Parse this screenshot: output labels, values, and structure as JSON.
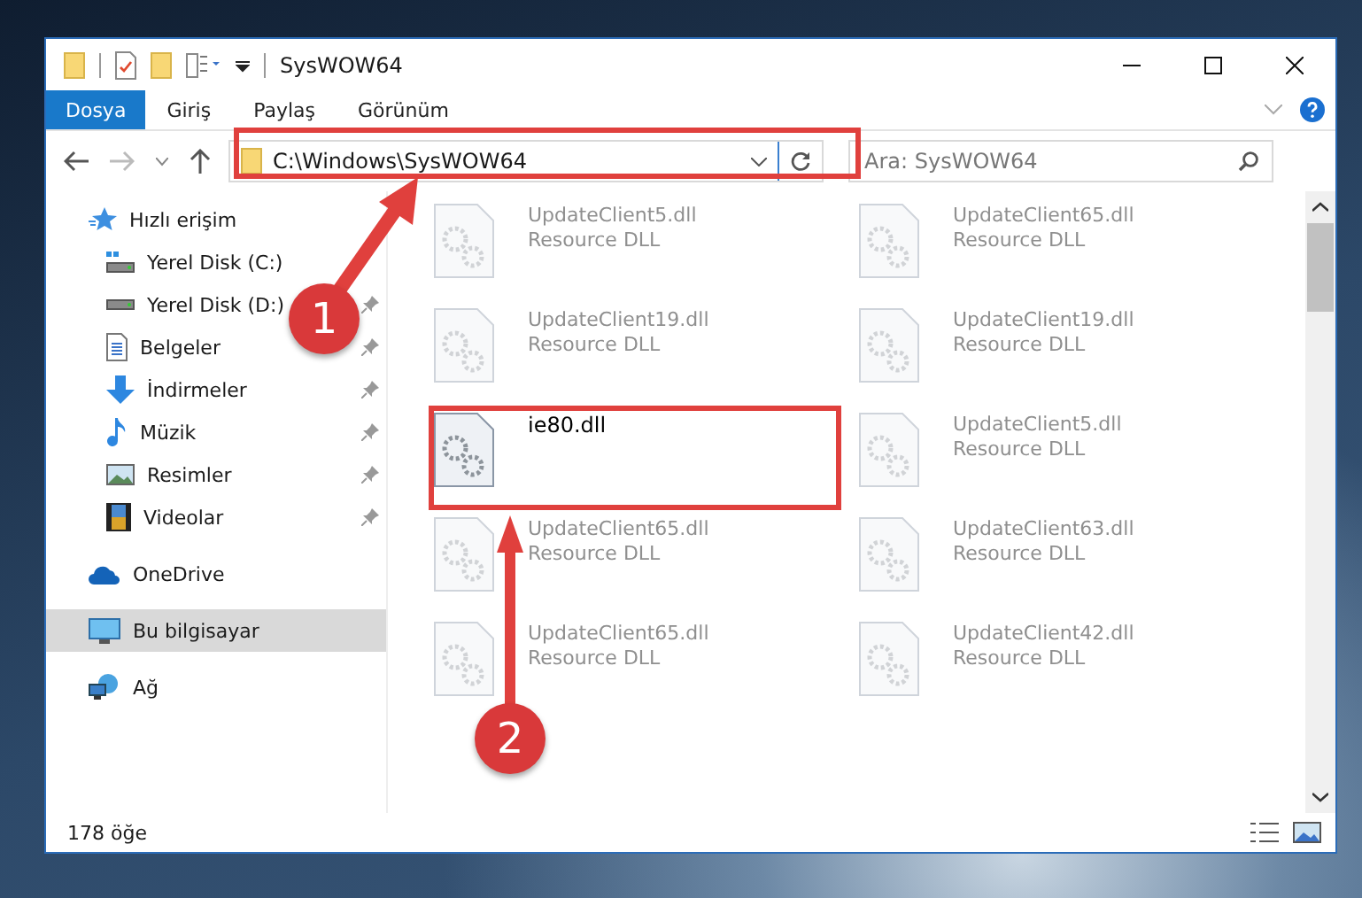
{
  "window": {
    "title": "SysWOW64"
  },
  "ribbon_tabs": [
    {
      "label": "Dosya",
      "selected": true
    },
    {
      "label": "Giriş",
      "selected": false
    },
    {
      "label": "Paylaş",
      "selected": false
    },
    {
      "label": "Görünüm",
      "selected": false
    }
  ],
  "address": {
    "value": "C:\\Windows\\SysWOW64"
  },
  "search": {
    "placeholder": "Ara: SysWOW64"
  },
  "sidebar": {
    "groups": [
      {
        "label": "Hızlı erişim",
        "selected": false,
        "children": [
          {
            "label": "Yerel Disk (C:)",
            "pinned": false
          },
          {
            "label": "Yerel Disk (D:)",
            "pinned": true
          },
          {
            "label": "Belgeler",
            "pinned": true
          },
          {
            "label": "İndirmeler",
            "pinned": true
          },
          {
            "label": "Müzik",
            "pinned": true
          },
          {
            "label": "Resimler",
            "pinned": true
          },
          {
            "label": "Videolar",
            "pinned": true
          }
        ]
      },
      {
        "label": "OneDrive",
        "selected": false
      },
      {
        "label": "Bu bilgisayar",
        "selected": true
      },
      {
        "label": "Ağ",
        "selected": false
      }
    ]
  },
  "files": [
    {
      "name": "UpdateClient5.dll",
      "type": "Resource DLL",
      "highlighted": false
    },
    {
      "name": "UpdateClient65.dll",
      "type": "Resource DLL",
      "highlighted": false
    },
    {
      "name": "UpdateClient19.dll",
      "type": "Resource DLL",
      "highlighted": false
    },
    {
      "name": "UpdateClient19.dll",
      "type": "Resource DLL",
      "highlighted": false
    },
    {
      "name": "ie80.dll",
      "highlighted": true
    },
    {
      "name": "UpdateClient5.dll",
      "type": "Resource DLL",
      "highlighted": false
    },
    {
      "name": "UpdateClient65.dll",
      "type": "Resource DLL",
      "highlighted": false
    },
    {
      "name": "UpdateClient63.dll",
      "type": "Resource DLL",
      "highlighted": false
    },
    {
      "name": "UpdateClient65.dll",
      "type": "Resource DLL",
      "highlighted": false
    },
    {
      "name": "UpdateClient42.dll",
      "type": "Resource DLL",
      "highlighted": false
    }
  ],
  "status_bar": {
    "count": "178 öğe"
  },
  "annotations": [
    {
      "label": "1"
    },
    {
      "label": "2"
    }
  ]
}
